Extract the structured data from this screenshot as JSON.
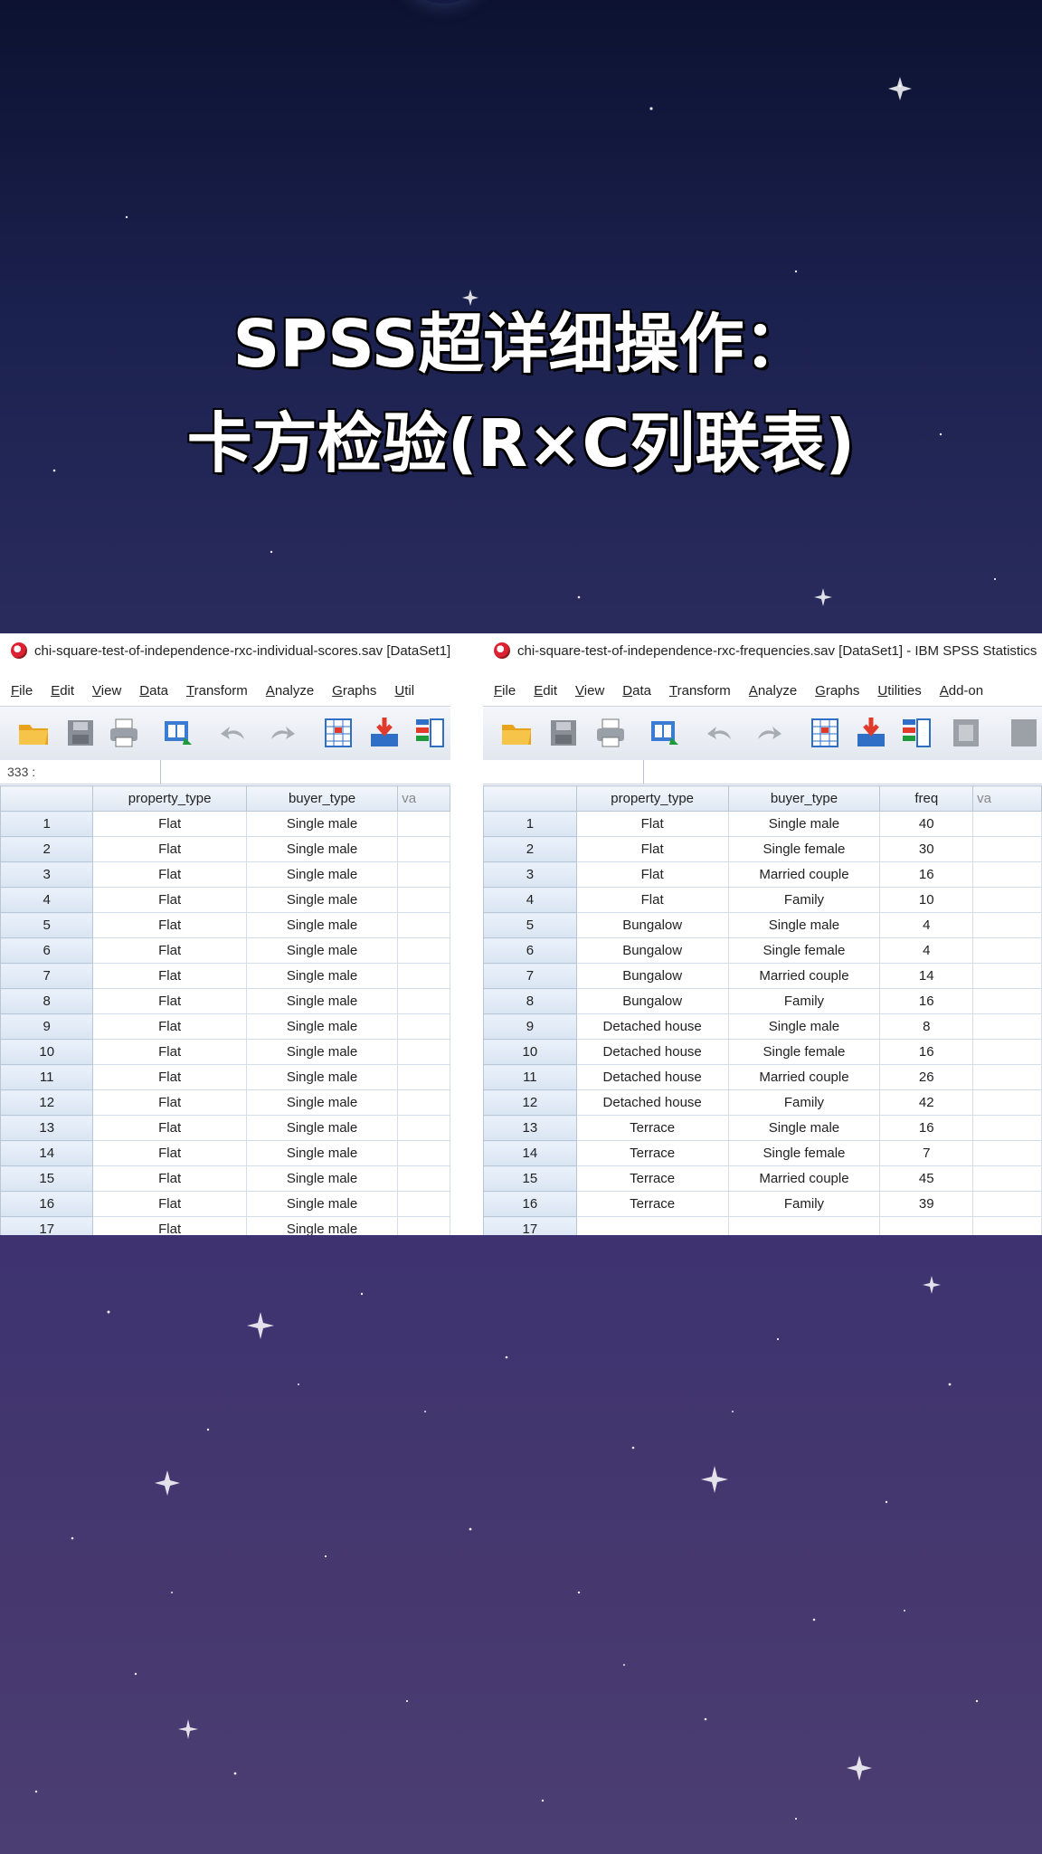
{
  "title": {
    "line1": "SPSS超详细操作：",
    "line2": "卡方检验(R×C列联表)"
  },
  "left_window": {
    "title": "chi-square-test-of-independence-rxc-individual-scores.sav [DataSet1]",
    "menu": [
      "File",
      "Edit",
      "View",
      "Data",
      "Transform",
      "Analyze",
      "Graphs",
      "Util"
    ],
    "cell_ref": "333 :",
    "columns": [
      "property_type",
      "buyer_type",
      "va"
    ],
    "rows": [
      {
        "n": "1",
        "property_type": "Flat",
        "buyer_type": "Single male"
      },
      {
        "n": "2",
        "property_type": "Flat",
        "buyer_type": "Single male"
      },
      {
        "n": "3",
        "property_type": "Flat",
        "buyer_type": "Single male"
      },
      {
        "n": "4",
        "property_type": "Flat",
        "buyer_type": "Single male"
      },
      {
        "n": "5",
        "property_type": "Flat",
        "buyer_type": "Single male"
      },
      {
        "n": "6",
        "property_type": "Flat",
        "buyer_type": "Single male"
      },
      {
        "n": "7",
        "property_type": "Flat",
        "buyer_type": "Single male"
      },
      {
        "n": "8",
        "property_type": "Flat",
        "buyer_type": "Single male"
      },
      {
        "n": "9",
        "property_type": "Flat",
        "buyer_type": "Single male"
      },
      {
        "n": "10",
        "property_type": "Flat",
        "buyer_type": "Single male"
      },
      {
        "n": "11",
        "property_type": "Flat",
        "buyer_type": "Single male"
      },
      {
        "n": "12",
        "property_type": "Flat",
        "buyer_type": "Single male"
      },
      {
        "n": "13",
        "property_type": "Flat",
        "buyer_type": "Single male"
      },
      {
        "n": "14",
        "property_type": "Flat",
        "buyer_type": "Single male"
      },
      {
        "n": "15",
        "property_type": "Flat",
        "buyer_type": "Single male"
      },
      {
        "n": "16",
        "property_type": "Flat",
        "buyer_type": "Single male"
      },
      {
        "n": "17",
        "property_type": "Flat",
        "buyer_type": "Single male"
      }
    ]
  },
  "right_window": {
    "title": "chi-square-test-of-independence-rxc-frequencies.sav [DataSet1] - IBM SPSS Statistics",
    "menu": [
      "File",
      "Edit",
      "View",
      "Data",
      "Transform",
      "Analyze",
      "Graphs",
      "Utilities",
      "Add-on"
    ],
    "cell_ref": "",
    "columns": [
      "property_type",
      "buyer_type",
      "freq",
      "va"
    ],
    "rows": [
      {
        "n": "1",
        "property_type": "Flat",
        "buyer_type": "Single male",
        "freq": "40"
      },
      {
        "n": "2",
        "property_type": "Flat",
        "buyer_type": "Single female",
        "freq": "30"
      },
      {
        "n": "3",
        "property_type": "Flat",
        "buyer_type": "Married couple",
        "freq": "16"
      },
      {
        "n": "4",
        "property_type": "Flat",
        "buyer_type": "Family",
        "freq": "10"
      },
      {
        "n": "5",
        "property_type": "Bungalow",
        "buyer_type": "Single male",
        "freq": "4"
      },
      {
        "n": "6",
        "property_type": "Bungalow",
        "buyer_type": "Single female",
        "freq": "4"
      },
      {
        "n": "7",
        "property_type": "Bungalow",
        "buyer_type": "Married couple",
        "freq": "14"
      },
      {
        "n": "8",
        "property_type": "Bungalow",
        "buyer_type": "Family",
        "freq": "16"
      },
      {
        "n": "9",
        "property_type": "Detached house",
        "buyer_type": "Single male",
        "freq": "8"
      },
      {
        "n": "10",
        "property_type": "Detached house",
        "buyer_type": "Single female",
        "freq": "16"
      },
      {
        "n": "11",
        "property_type": "Detached house",
        "buyer_type": "Married couple",
        "freq": "26"
      },
      {
        "n": "12",
        "property_type": "Detached house",
        "buyer_type": "Family",
        "freq": "42"
      },
      {
        "n": "13",
        "property_type": "Terrace",
        "buyer_type": "Single male",
        "freq": "16"
      },
      {
        "n": "14",
        "property_type": "Terrace",
        "buyer_type": "Single female",
        "freq": "7"
      },
      {
        "n": "15",
        "property_type": "Terrace",
        "buyer_type": "Married couple",
        "freq": "45"
      },
      {
        "n": "16",
        "property_type": "Terrace",
        "buyer_type": "Family",
        "freq": "39"
      },
      {
        "n": "17",
        "property_type": "",
        "buyer_type": "",
        "freq": ""
      }
    ]
  },
  "toolbar_icons": [
    "open-folder-icon",
    "save-icon",
    "print-icon",
    "recall-dialog-icon",
    "undo-icon",
    "redo-icon",
    "goto-case-icon",
    "goto-variable-icon",
    "variables-icon",
    "find-icon"
  ],
  "colors": {
    "header_bg": "#dfe8f3",
    "grid_line": "#d4dde8",
    "sky_top": "#0c1230",
    "sky_bottom": "#4b3e72"
  }
}
